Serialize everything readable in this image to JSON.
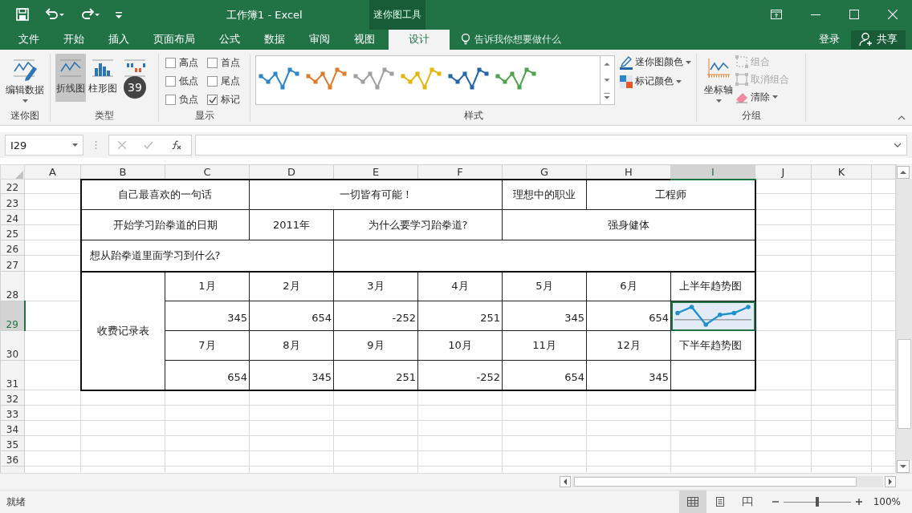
{
  "window": {
    "title": "工作簿1 - Excel",
    "context_group": "迷你图工具"
  },
  "quick_access": [
    {
      "kind": "save"
    },
    {
      "kind": "undo"
    },
    {
      "kind": "redo"
    },
    {
      "kind": "customize"
    }
  ],
  "tabs": [
    {
      "label": "文件",
      "selected": false
    },
    {
      "label": "开始",
      "selected": false
    },
    {
      "label": "插入",
      "selected": false
    },
    {
      "label": "页面布局",
      "selected": false
    },
    {
      "label": "公式",
      "selected": false
    },
    {
      "label": "数据",
      "selected": false
    },
    {
      "label": "审阅",
      "selected": false
    },
    {
      "label": "视图",
      "selected": false
    },
    {
      "label": "设计",
      "selected": true
    }
  ],
  "tell_me": {
    "placeholder": "告诉我你想要做什么"
  },
  "account": {
    "sign_in": "登录",
    "share": "共享"
  },
  "ribbon": {
    "sparkline_group": {
      "label": "迷你图",
      "edit_data": "编辑数据"
    },
    "type_group": {
      "label": "类型",
      "types": [
        {
          "kind": "line",
          "label": "折线图",
          "selected": true
        },
        {
          "kind": "column",
          "label": "柱形图",
          "selected": false
        },
        {
          "kind": "winloss",
          "selected": false
        }
      ]
    },
    "show_group": {
      "label": "显示",
      "options": [
        {
          "label": "高点",
          "checked": false
        },
        {
          "label": "首点",
          "checked": false
        },
        {
          "label": "低点",
          "checked": false
        },
        {
          "label": "尾点",
          "checked": false
        },
        {
          "label": "负点",
          "checked": false
        },
        {
          "label": "标记",
          "checked": true
        }
      ]
    },
    "style_group": {
      "label": "样式",
      "styles": [
        {
          "color": "#2e86c8"
        },
        {
          "color": "#e07b2a"
        },
        {
          "color": "#a0a0a0"
        },
        {
          "color": "#e5b50e"
        },
        {
          "color": "#2466a8"
        },
        {
          "color": "#4ea24e"
        }
      ],
      "color_buttons": [
        {
          "kind": "sparkline_color",
          "label": "迷你图颜色"
        },
        {
          "kind": "marker_color",
          "label": "标记颜色"
        }
      ]
    },
    "group_group": {
      "label": "分组",
      "axis": "坐标轴",
      "actions": [
        {
          "kind": "group",
          "label": "组合",
          "disabled": true
        },
        {
          "kind": "ungroup",
          "label": "取消组合",
          "disabled": true
        },
        {
          "kind": "clear",
          "label": "清除",
          "disabled": false
        }
      ]
    }
  },
  "tutorial_overlay": {
    "step": "39"
  },
  "formula_bar": {
    "name_box": "I29"
  },
  "sheet": {
    "columns": [
      {
        "label": "A",
        "selected": false
      },
      {
        "label": "B",
        "selected": false
      },
      {
        "label": "C",
        "selected": false
      },
      {
        "label": "D",
        "selected": false
      },
      {
        "label": "E",
        "selected": false
      },
      {
        "label": "F",
        "selected": false
      },
      {
        "label": "G",
        "selected": false
      },
      {
        "label": "H",
        "selected": false
      },
      {
        "label": "I",
        "selected": true
      },
      {
        "label": "J",
        "selected": false
      },
      {
        "label": "K",
        "selected": false
      }
    ],
    "rows": [
      {
        "label": "22",
        "selected": false
      },
      {
        "label": "23",
        "selected": false
      },
      {
        "label": "24",
        "selected": false
      },
      {
        "label": "25",
        "selected": false
      },
      {
        "label": "26",
        "selected": false
      },
      {
        "label": "27",
        "selected": false
      },
      {
        "label": "28",
        "selected": false
      },
      {
        "label": "29",
        "selected": true
      },
      {
        "label": "30",
        "selected": false
      },
      {
        "label": "31",
        "selected": false
      },
      {
        "label": "32",
        "selected": false
      },
      {
        "label": "33",
        "selected": false
      },
      {
        "label": "34",
        "selected": false
      },
      {
        "label": "35",
        "selected": false
      },
      {
        "label": "36",
        "selected": false
      }
    ],
    "info_rows": [
      [
        "自己最喜欢的一句话",
        "一切皆有可能！",
        "理想中的职业",
        "工程师"
      ],
      [
        "开始学习跆拳道的日期",
        "2011年",
        "为什么要学习跆拳道?",
        "强身健体"
      ],
      [
        "想从跆拳道里面学习到什么?"
      ]
    ],
    "fee_table": {
      "title": "收费记录表",
      "halves": [
        {
          "months": [
            "1月",
            "2月",
            "3月",
            "4月",
            "5月",
            "6月"
          ],
          "values": [
            "345",
            "654",
            "-252",
            "251",
            "345",
            "654"
          ],
          "trend_label": "上半年趋势图",
          "has_sparkline": true,
          "selected": true
        },
        {
          "months": [
            "7月",
            "8月",
            "9月",
            "10月",
            "11月",
            "12月"
          ],
          "values": [
            "654",
            "345",
            "251",
            "-252",
            "654",
            "345"
          ],
          "trend_label": "下半年趋势图",
          "has_sparkline": false,
          "selected": false
        }
      ]
    }
  },
  "status_bar": {
    "status": "就绪",
    "view_modes": [
      {
        "kind": "normal",
        "selected": true
      },
      {
        "kind": "page_layout",
        "selected": false
      },
      {
        "kind": "page_break",
        "selected": false
      }
    ],
    "zoom": {
      "level": 0.5,
      "reading": "100%"
    }
  }
}
